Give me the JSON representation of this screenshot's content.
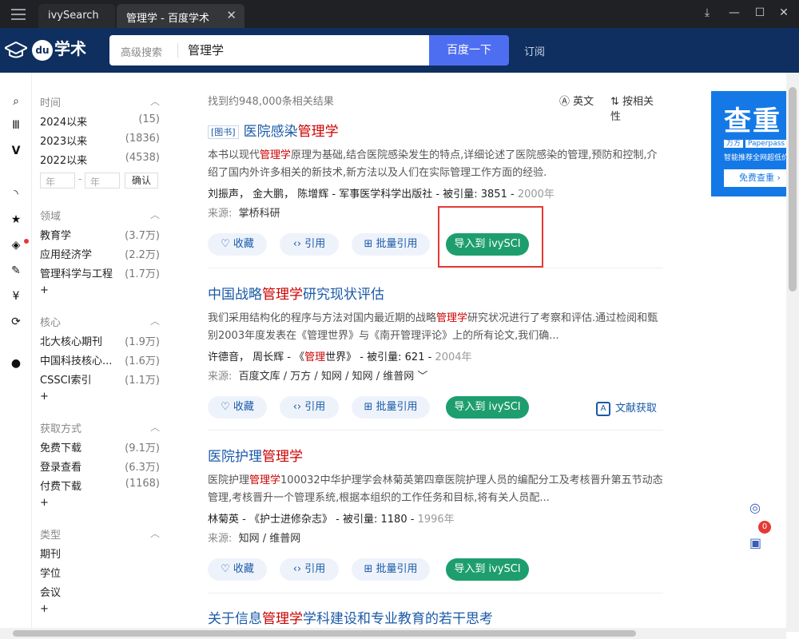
{
  "window": {
    "tabs": [
      {
        "label": "ivySearch"
      },
      {
        "label": "管理学 - 百度学术"
      }
    ]
  },
  "header": {
    "logo_text": "学术",
    "advanced_search": "高级搜索",
    "query": "管理学",
    "search_button": "百度一下",
    "subscribe": "订阅"
  },
  "filters": {
    "time": {
      "label": "时间",
      "items": [
        {
          "label": "2024以来",
          "count": "(15)"
        },
        {
          "label": "2023以来",
          "count": "(1836)"
        },
        {
          "label": "2022以来",
          "count": "(4538)"
        }
      ],
      "year_from_placeholder": "年",
      "year_to_placeholder": "年",
      "dash": "-",
      "confirm": "确认"
    },
    "field": {
      "label": "领域",
      "items": [
        {
          "label": "教育学",
          "count": "(3.7万)"
        },
        {
          "label": "应用经济学",
          "count": "(2.2万)"
        },
        {
          "label": "管理科学与工程",
          "count": "(1.7万)"
        }
      ],
      "more": "+"
    },
    "core": {
      "label": "核心",
      "items": [
        {
          "label": "北大核心期刊",
          "count": "(1.9万)"
        },
        {
          "label": "中国科技核心...",
          "count": "(1.6万)"
        },
        {
          "label": "CSSCI索引",
          "count": "(1.1万)"
        }
      ],
      "more": "+"
    },
    "access": {
      "label": "获取方式",
      "items": [
        {
          "label": "免费下载",
          "count": "(9.1万)"
        },
        {
          "label": "登录查看",
          "count": "(6.3万)"
        },
        {
          "label": "付费下载",
          "count": "(1168)"
        }
      ],
      "more": "+"
    },
    "type": {
      "label": "类型",
      "items": [
        {
          "label": "期刊"
        },
        {
          "label": "学位"
        },
        {
          "label": "会议"
        }
      ],
      "more": "+"
    }
  },
  "results_meta": {
    "count_text": "找到约948,000条相关结果",
    "english": "英文",
    "sort": "按相关性"
  },
  "results": [
    {
      "badge": "[图书]",
      "title_pre": "医院感染",
      "title_hl": "管理学",
      "title_post": "",
      "abstract_pre": "本书以现代",
      "abstract_hl": "管理学",
      "abstract_post": "原理为基础,结合医院感染发生的特点,详细论述了医院感染的管理,预防和控制,介绍了国内外许多相关的新技术,新方法以及人们在实际管理工作方面的经验.",
      "authors": "刘振声，  金大鹏，  陈增辉",
      "publisher_pre": "",
      "publisher_hl": "",
      "publisher_post": "军事医学科学出版社",
      "cited_label": "被引量:",
      "cited": "3851",
      "year": "2000年",
      "source_label": "来源:",
      "sources": "掌桥科研"
    },
    {
      "badge": "",
      "title_pre": "中国战略",
      "title_hl": "管理学",
      "title_post": "研究现状评估",
      "abstract_pre": "我们采用结构化的程序与方法对国内最近期的战略",
      "abstract_hl": "管理学",
      "abstract_post": "研究状况进行了考察和评估.通过检阅和甄别2003年度发表在《管理世界》与《南开管理评论》上的所有论文,我们确...",
      "authors": "许德音，  周长辉",
      "publisher_pre": "《",
      "publisher_hl": "管理",
      "publisher_post": "世界》",
      "cited_label": "被引量:",
      "cited": "621",
      "year": "2004年",
      "source_label": "来源:",
      "sources": "百度文库 / 万方 / 知网 / 知网 / 维普网 ﹀",
      "doc_fetch": "文献获取"
    },
    {
      "badge": "",
      "title_pre": "医院护理",
      "title_hl": "管理学",
      "title_post": "",
      "abstract_pre": "医院护理",
      "abstract_hl": "管理学",
      "abstract_post": "100032中华护理学会林菊英第四章医院护理人员的编配分工及考核晋升第五节动态管理,考核晋升一个管理系统,根据本组织的工作任务和目标,将有关人员配...",
      "authors": "林菊英",
      "publisher_pre": "",
      "publisher_hl": "",
      "publisher_post": "《护士进修杂志》",
      "cited_label": "被引量:",
      "cited": "1180",
      "year": "1996年",
      "source_label": "来源:",
      "sources": "知网 / 维普网"
    },
    {
      "title_pre": "关于信息",
      "title_hl": "管理学",
      "title_post": "学科建设和专业教育的若干思考"
    }
  ],
  "actions": {
    "favorite": "收藏",
    "cite": "引用",
    "batch_cite": "批量引用",
    "import": "导入到 ivySCI"
  },
  "ad": {
    "big": "查重",
    "tag1": "万方",
    "tag2": "Paperpass",
    "line": "智能推荐全网超低价",
    "button": "免费查重 ›"
  },
  "float": {
    "badge_count": "0"
  }
}
